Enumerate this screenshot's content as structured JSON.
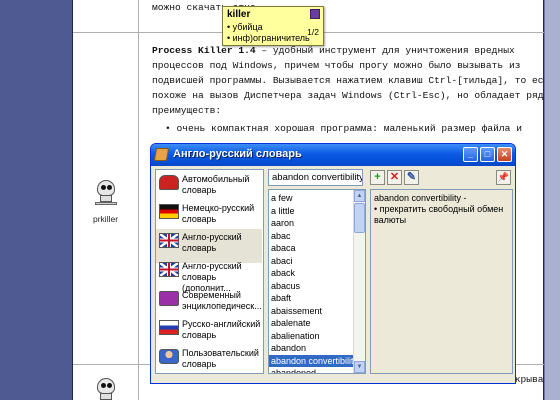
{
  "document": {
    "line_top": "можно скачать                        атно.",
    "process_killer_name": "Process Killer 1.4",
    "process_killer_rest": " – удобный инструмент для уничтожения вредных",
    "para_lines": [
      "процессов под Windows, причем чтобы прогу можно было вызывать из",
      "подвисшей программы. Вызывается нажатием клавиш Ctrl-[тильда], то есть",
      "похоже на вызов Диспетчера задач Windows (Ctrl-Esc), но обладает рядом",
      "преимуществ:"
    ],
    "bullet": "• очень компактная хорошая программа: маленький размер файла и",
    "caption_prkiller": "prkiller",
    "bottom_line": "файлам. FileMonitor поможет легко увидеть, какая из программ открывает"
  },
  "tooltip": {
    "word": "killer",
    "lines": [
      "• убийца",
      "• инф)ограничитель"
    ],
    "page": "1/2"
  },
  "window": {
    "title": "Англо-русский словарь",
    "buttons": {
      "minimize": "_",
      "maximize": "□",
      "close": "✕"
    },
    "dictionaries": [
      {
        "label": "Автомобильный словарь",
        "icon": "car-icon"
      },
      {
        "label": "Немецко-русский словарь",
        "icon": "germany-flag-icon"
      },
      {
        "label": "Англо-русский словарь",
        "icon": "uk-flag-icon",
        "selected": true
      },
      {
        "label": "Англо-русский словарь (дополнит...",
        "icon": "uk-flag-icon"
      },
      {
        "label": "Современный энциклопедическ...",
        "icon": "book-icon"
      },
      {
        "label": "Русско-английский словарь",
        "icon": "russia-flag-icon"
      },
      {
        "label": "Пользовательский словарь",
        "icon": "user-icon"
      }
    ],
    "search_value": "abandon convertibility",
    "words": [
      "a few",
      "a little",
      "aaron",
      "abac",
      "abaca",
      "abaci",
      "aback",
      "abacus",
      "abaft",
      "abaissement",
      "abalenate",
      "abalienation",
      "abandon",
      "abandon convertibility",
      "abandoned"
    ],
    "selected_word": "abandon convertibility",
    "translation": [
      "abandon convertibility -",
      "• прекратить свободный обмен",
      "валюты"
    ],
    "tools": {
      "add": "+",
      "delete": "✕",
      "edit": "✎",
      "pin": "📌"
    },
    "colors": {
      "title_blue": "#0a5ae5",
      "selection": "#316ac5",
      "add_green": "#2a9a2a",
      "delete_red": "#cc2222"
    }
  }
}
